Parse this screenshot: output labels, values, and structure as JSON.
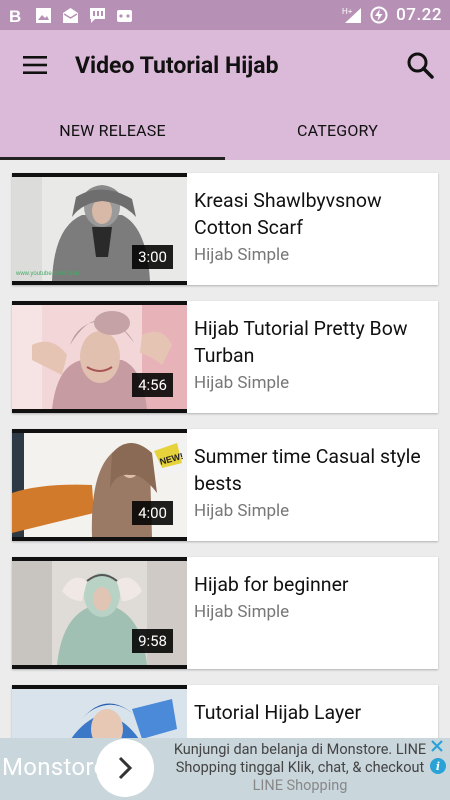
{
  "status_bar": {
    "time": "07.22",
    "network": "H+",
    "icons": [
      "b-app-icon",
      "image-icon",
      "mail-icon",
      "chat-icon",
      "game-icon",
      "signal-icon",
      "battery-charging-icon"
    ]
  },
  "app_bar": {
    "title": "Video Tutorial Hijab",
    "menu_icon": "hamburger-menu-icon",
    "search_icon": "search-icon"
  },
  "tabs": [
    {
      "label": "NEW RELEASE",
      "active": true
    },
    {
      "label": "CATEGORY",
      "active": false
    }
  ],
  "videos": [
    {
      "title": "Kreasi Shawlbyvsnow Cotton Scarf",
      "channel": "Hijab Simple",
      "duration": "3:00"
    },
    {
      "title": "Hijab Tutorial Pretty Bow Turban",
      "channel": "Hijab Simple",
      "duration": "4:56"
    },
    {
      "title": "Summer time Casual style bests",
      "channel": "Hijab Simple",
      "duration": "4:00"
    },
    {
      "title": "Hijab for beginner",
      "channel": "Hijab Simple",
      "duration": "9:58"
    },
    {
      "title": "Tutorial Hijab Layer",
      "channel": "",
      "duration": ""
    }
  ],
  "ad": {
    "brand": "Monstore",
    "line1": "Kunjungi dan belanja di Monstore. LINE",
    "line2": "Shopping tinggal Klik, chat, & checkout",
    "line3": "LINE Shopping"
  },
  "colors": {
    "status_bar": "#b791b5",
    "app_bar": "#dbb9d8",
    "list_background": "#ececec"
  }
}
